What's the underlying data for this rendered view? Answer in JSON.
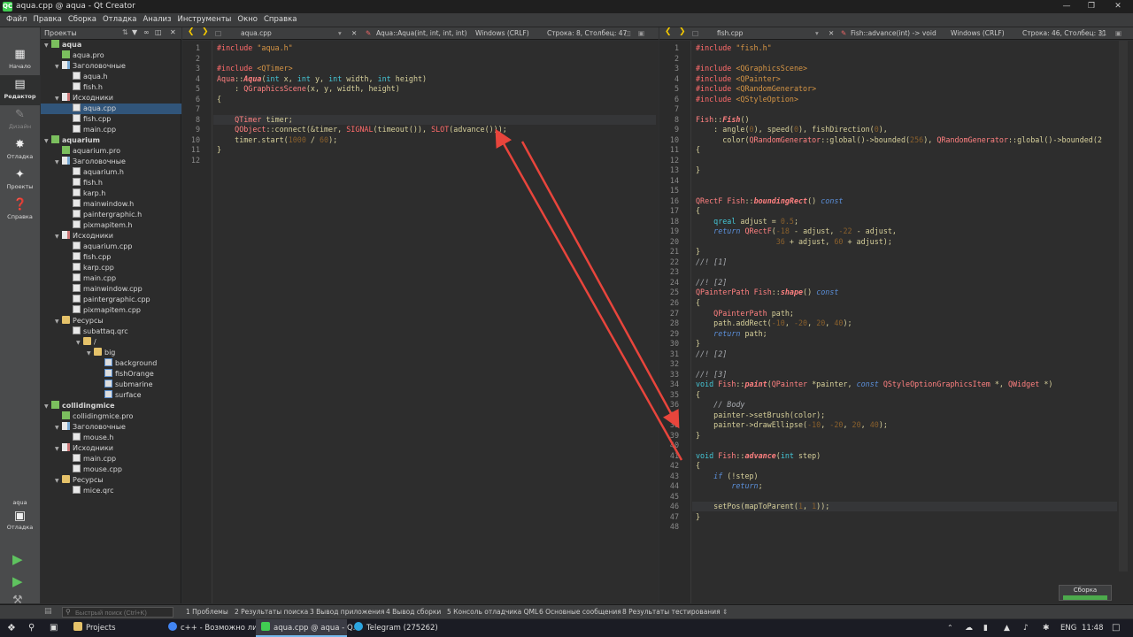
{
  "window": {
    "title": "aqua.cpp @ aqua - Qt Creator",
    "app_badge": "QC"
  },
  "menu": [
    "Файл",
    "Правка",
    "Сборка",
    "Отладка",
    "Анализ",
    "Инструменты",
    "Окно",
    "Справка"
  ],
  "modes": [
    {
      "label": "Начало",
      "icon": "grid-icon"
    },
    {
      "label": "Редактор",
      "icon": "editor-icon"
    },
    {
      "label": "Дизайн",
      "icon": "pen-icon"
    },
    {
      "label": "Отладка",
      "icon": "bug-icon"
    },
    {
      "label": "Проекты",
      "icon": "wrench-icon"
    },
    {
      "label": "Справка",
      "icon": "help-icon"
    }
  ],
  "kit": {
    "project": "aqua",
    "mode": "Отладка"
  },
  "projects_panel": {
    "title": "Проекты"
  },
  "tree": [
    {
      "label": "aqua",
      "kind": "pro",
      "level": 0
    },
    {
      "label": "aqua.pro",
      "kind": "pro",
      "level": 1
    },
    {
      "label": "Заголовочные",
      "kind": "hdr",
      "level": 1
    },
    {
      "label": "aqua.h",
      "kind": "file",
      "level": 2
    },
    {
      "label": "fish.h",
      "kind": "file",
      "level": 2
    },
    {
      "label": "Исходники",
      "kind": "src",
      "level": 1
    },
    {
      "label": "aqua.cpp",
      "kind": "file",
      "level": 2
    },
    {
      "label": "fish.cpp",
      "kind": "file",
      "level": 2
    },
    {
      "label": "main.cpp",
      "kind": "file",
      "level": 2
    },
    {
      "label": "aquarium",
      "kind": "pro",
      "level": 0
    },
    {
      "label": "aquarium.pro",
      "kind": "pro",
      "level": 1
    },
    {
      "label": "Заголовочные",
      "kind": "hdr",
      "level": 1
    },
    {
      "label": "aquarium.h",
      "kind": "file",
      "level": 2
    },
    {
      "label": "fish.h",
      "kind": "file",
      "level": 2
    },
    {
      "label": "karp.h",
      "kind": "file",
      "level": 2
    },
    {
      "label": "mainwindow.h",
      "kind": "file",
      "level": 2
    },
    {
      "label": "paintergraphic.h",
      "kind": "file",
      "level": 2
    },
    {
      "label": "pixmapitem.h",
      "kind": "file",
      "level": 2
    },
    {
      "label": "Исходники",
      "kind": "src",
      "level": 1
    },
    {
      "label": "aquarium.cpp",
      "kind": "file",
      "level": 2
    },
    {
      "label": "fish.cpp",
      "kind": "file",
      "level": 2
    },
    {
      "label": "karp.cpp",
      "kind": "file",
      "level": 2
    },
    {
      "label": "main.cpp",
      "kind": "file",
      "level": 2
    },
    {
      "label": "mainwindow.cpp",
      "kind": "file",
      "level": 2
    },
    {
      "label": "paintergraphic.cpp",
      "kind": "file",
      "level": 2
    },
    {
      "label": "pixmapitem.cpp",
      "kind": "file",
      "level": 2
    },
    {
      "label": "Ресурсы",
      "kind": "folder",
      "level": 1
    },
    {
      "label": "subattaq.qrc",
      "kind": "file",
      "level": 2
    },
    {
      "label": "/",
      "kind": "folder",
      "level": 3
    },
    {
      "label": "big",
      "kind": "folder",
      "level": 4
    },
    {
      "label": "background",
      "kind": "img",
      "level": 5
    },
    {
      "label": "fishOrange",
      "kind": "img",
      "level": 5
    },
    {
      "label": "submarine",
      "kind": "img",
      "level": 5
    },
    {
      "label": "surface",
      "kind": "img",
      "level": 5
    },
    {
      "label": "collidingmice",
      "kind": "pro",
      "level": 0
    },
    {
      "label": "collidingmice.pro",
      "kind": "pro",
      "level": 1
    },
    {
      "label": "Заголовочные",
      "kind": "hdr",
      "level": 1
    },
    {
      "label": "mouse.h",
      "kind": "file",
      "level": 2
    },
    {
      "label": "Исходники",
      "kind": "src",
      "level": 1
    },
    {
      "label": "main.cpp",
      "kind": "file",
      "level": 2
    },
    {
      "label": "mouse.cpp",
      "kind": "file",
      "level": 2
    },
    {
      "label": "Ресурсы",
      "kind": "folder",
      "level": 1
    },
    {
      "label": "mice.qrc",
      "kind": "file",
      "level": 2
    }
  ],
  "editor_left": {
    "file": "aqua.cpp",
    "function": "Aqua::Aqua(int, int, int, int)",
    "encoding": "Windows (CRLF)",
    "position": "Строка: 8, Столбец: 47",
    "lines": [
      [
        [
          "pp",
          "#include "
        ],
        [
          "str",
          "\"aqua.h\""
        ]
      ],
      [],
      [
        [
          "pp",
          "#include "
        ],
        [
          "str",
          "<QTimer>"
        ]
      ],
      [
        [
          "ty",
          "Aqua"
        ],
        [
          "id",
          "::"
        ],
        [
          "fn",
          "Aqua"
        ],
        [
          "id",
          "("
        ],
        [
          "kw",
          "int"
        ],
        [
          "id",
          " x, "
        ],
        [
          "kw",
          "int"
        ],
        [
          "id",
          " y, "
        ],
        [
          "kw",
          "int"
        ],
        [
          "id",
          " width, "
        ],
        [
          "kw",
          "int"
        ],
        [
          "id",
          " height)"
        ]
      ],
      [
        [
          "id",
          "    : "
        ],
        [
          "ty",
          "QGraphicsScene"
        ],
        [
          "id",
          "(x, y, width, height)"
        ]
      ],
      [
        [
          "id",
          "{"
        ]
      ],
      [],
      [
        [
          "id",
          "    "
        ],
        [
          "ty",
          "QTimer"
        ],
        [
          "id",
          " timer;"
        ]
      ],
      [
        [
          "id",
          "    "
        ],
        [
          "ty",
          "QObject"
        ],
        [
          "id",
          "::connect(&timer, "
        ],
        [
          "pp",
          "SIGNAL"
        ],
        [
          "id",
          "(timeout()), "
        ],
        [
          "pp",
          "SLOT"
        ],
        [
          "id",
          "(advance()));"
        ]
      ],
      [
        [
          "id",
          "    timer.start("
        ],
        [
          "num",
          "1000"
        ],
        [
          "id",
          " / "
        ],
        [
          "num",
          "60"
        ],
        [
          "id",
          ");"
        ]
      ],
      [
        [
          "id",
          "}"
        ]
      ],
      []
    ]
  },
  "editor_right": {
    "file": "fish.cpp",
    "function": "Fish::advance(int) -> void",
    "encoding": "Windows (CRLF)",
    "position": "Строка: 46, Столбец: 31",
    "lines": [
      [
        [
          "pp",
          "#include "
        ],
        [
          "str",
          "\"fish.h\""
        ]
      ],
      [],
      [
        [
          "pp",
          "#include "
        ],
        [
          "str",
          "<QGraphicsScene>"
        ]
      ],
      [
        [
          "pp",
          "#include "
        ],
        [
          "str",
          "<QPainter>"
        ]
      ],
      [
        [
          "pp",
          "#include "
        ],
        [
          "str",
          "<QRandomGenerator>"
        ]
      ],
      [
        [
          "pp",
          "#include "
        ],
        [
          "str",
          "<QStyleOption>"
        ]
      ],
      [],
      [
        [
          "ty",
          "Fish"
        ],
        [
          "id",
          "::"
        ],
        [
          "fn",
          "Fish"
        ],
        [
          "id",
          "()"
        ]
      ],
      [
        [
          "id",
          "    : angle("
        ],
        [
          "num",
          "0"
        ],
        [
          "id",
          "), speed("
        ],
        [
          "num",
          "0"
        ],
        [
          "id",
          "), fishDirection("
        ],
        [
          "num",
          "0"
        ],
        [
          "id",
          "),"
        ]
      ],
      [
        [
          "id",
          "      color("
        ],
        [
          "ty",
          "QRandomGenerator"
        ],
        [
          "id",
          "::global()->bounded("
        ],
        [
          "num",
          "256"
        ],
        [
          "id",
          "), "
        ],
        [
          "ty",
          "QRandomGenerator"
        ],
        [
          "id",
          "::global()->bounded(2"
        ]
      ],
      [
        [
          "id",
          "{"
        ]
      ],
      [],
      [
        [
          "id",
          "}"
        ]
      ],
      [],
      [],
      [
        [
          "ty",
          "QRectF"
        ],
        [
          "id",
          " "
        ],
        [
          "ty",
          "Fish"
        ],
        [
          "id",
          "::"
        ],
        [
          "fn",
          "boundingRect"
        ],
        [
          "id",
          "() "
        ],
        [
          "kw2",
          "const"
        ]
      ],
      [
        [
          "id",
          "{"
        ]
      ],
      [
        [
          "id",
          "    "
        ],
        [
          "kw",
          "qreal"
        ],
        [
          "id",
          " adjust = "
        ],
        [
          "num",
          "0.5"
        ],
        [
          "id",
          ";"
        ]
      ],
      [
        [
          "id",
          "    "
        ],
        [
          "kw2",
          "return"
        ],
        [
          "id",
          " "
        ],
        [
          "ty",
          "QRectF"
        ],
        [
          "id",
          "("
        ],
        [
          "num",
          "-18"
        ],
        [
          "id",
          " - adjust, "
        ],
        [
          "num",
          "-22"
        ],
        [
          "id",
          " - adjust,"
        ]
      ],
      [
        [
          "id",
          "                  "
        ],
        [
          "num",
          "36"
        ],
        [
          "id",
          " + adjust, "
        ],
        [
          "num",
          "60"
        ],
        [
          "id",
          " + adjust);"
        ]
      ],
      [
        [
          "id",
          "}"
        ]
      ],
      [
        [
          "cm",
          "//! [1]"
        ]
      ],
      [],
      [
        [
          "cm",
          "//! [2]"
        ]
      ],
      [
        [
          "ty",
          "QPainterPath"
        ],
        [
          "id",
          " "
        ],
        [
          "ty",
          "Fish"
        ],
        [
          "id",
          "::"
        ],
        [
          "fn",
          "shape"
        ],
        [
          "id",
          "() "
        ],
        [
          "kw2",
          "const"
        ]
      ],
      [
        [
          "id",
          "{"
        ]
      ],
      [
        [
          "id",
          "    "
        ],
        [
          "ty",
          "QPainterPath"
        ],
        [
          "id",
          " path;"
        ]
      ],
      [
        [
          "id",
          "    path.addRect("
        ],
        [
          "num",
          "-10"
        ],
        [
          "id",
          ", "
        ],
        [
          "num",
          "-20"
        ],
        [
          "id",
          ", "
        ],
        [
          "num",
          "20"
        ],
        [
          "id",
          ", "
        ],
        [
          "num",
          "40"
        ],
        [
          "id",
          ");"
        ]
      ],
      [
        [
          "id",
          "    "
        ],
        [
          "kw2",
          "return"
        ],
        [
          "id",
          " path;"
        ]
      ],
      [
        [
          "id",
          "}"
        ]
      ],
      [
        [
          "cm",
          "//! [2]"
        ]
      ],
      [],
      [
        [
          "cm",
          "//! [3]"
        ]
      ],
      [
        [
          "kw",
          "void"
        ],
        [
          "id",
          " "
        ],
        [
          "ty",
          "Fish"
        ],
        [
          "id",
          "::"
        ],
        [
          "fn",
          "paint"
        ],
        [
          "id",
          "("
        ],
        [
          "ty",
          "QPainter"
        ],
        [
          "id",
          " *painter, "
        ],
        [
          "kw2",
          "const"
        ],
        [
          "id",
          " "
        ],
        [
          "ty",
          "QStyleOptionGraphicsItem"
        ],
        [
          "id",
          " *, "
        ],
        [
          "ty",
          "QWidget"
        ],
        [
          "id",
          " *)"
        ]
      ],
      [
        [
          "id",
          "{"
        ]
      ],
      [
        [
          "id",
          "    "
        ],
        [
          "cm",
          "// Body"
        ]
      ],
      [
        [
          "id",
          "    painter->setBrush(color);"
        ]
      ],
      [
        [
          "id",
          "    painter->drawEllipse("
        ],
        [
          "num",
          "-10"
        ],
        [
          "id",
          ", "
        ],
        [
          "num",
          "-20"
        ],
        [
          "id",
          ", "
        ],
        [
          "num",
          "20"
        ],
        [
          "id",
          ", "
        ],
        [
          "num",
          "40"
        ],
        [
          "id",
          ");"
        ]
      ],
      [
        [
          "id",
          "}"
        ]
      ],
      [],
      [
        [
          "kw",
          "void"
        ],
        [
          "id",
          " "
        ],
        [
          "ty",
          "Fish"
        ],
        [
          "id",
          "::"
        ],
        [
          "fn",
          "advance"
        ],
        [
          "id",
          "("
        ],
        [
          "kw",
          "int"
        ],
        [
          "id",
          " step)"
        ]
      ],
      [
        [
          "id",
          "{"
        ]
      ],
      [
        [
          "id",
          "    "
        ],
        [
          "kw2",
          "if"
        ],
        [
          "id",
          " (!step)"
        ]
      ],
      [
        [
          "id",
          "        "
        ],
        [
          "kw2",
          "return"
        ],
        [
          "id",
          ";"
        ]
      ],
      [],
      [
        [
          "id",
          "    setPos(mapToParent("
        ],
        [
          "num",
          "1"
        ],
        [
          "id",
          ", "
        ],
        [
          "num",
          "1"
        ],
        [
          "id",
          "));"
        ]
      ],
      [
        [
          "id",
          "}"
        ]
      ],
      []
    ]
  },
  "bottom": {
    "search_placeholder": "Быстрый поиск (Ctrl+K)",
    "panes": [
      "1 Проблемы",
      "2 Результаты поиска",
      "3 Вывод приложения",
      "4 Вывод сборки",
      "5 Консоль отладчика QML",
      "6 Основные сообщения",
      "8 Результаты тестирования"
    ]
  },
  "build_progress": {
    "label": "Сборка"
  },
  "taskbar": {
    "items": [
      "Projects",
      "c++ - Возможно ли ...",
      "aqua.cpp @ aqua - Q...",
      "Telegram (275262)"
    ],
    "lang": "ENG",
    "time": "11:48"
  },
  "colors": {
    "accent": "#41cd52",
    "selection": "#31557a",
    "arrow": "#e8453c"
  }
}
